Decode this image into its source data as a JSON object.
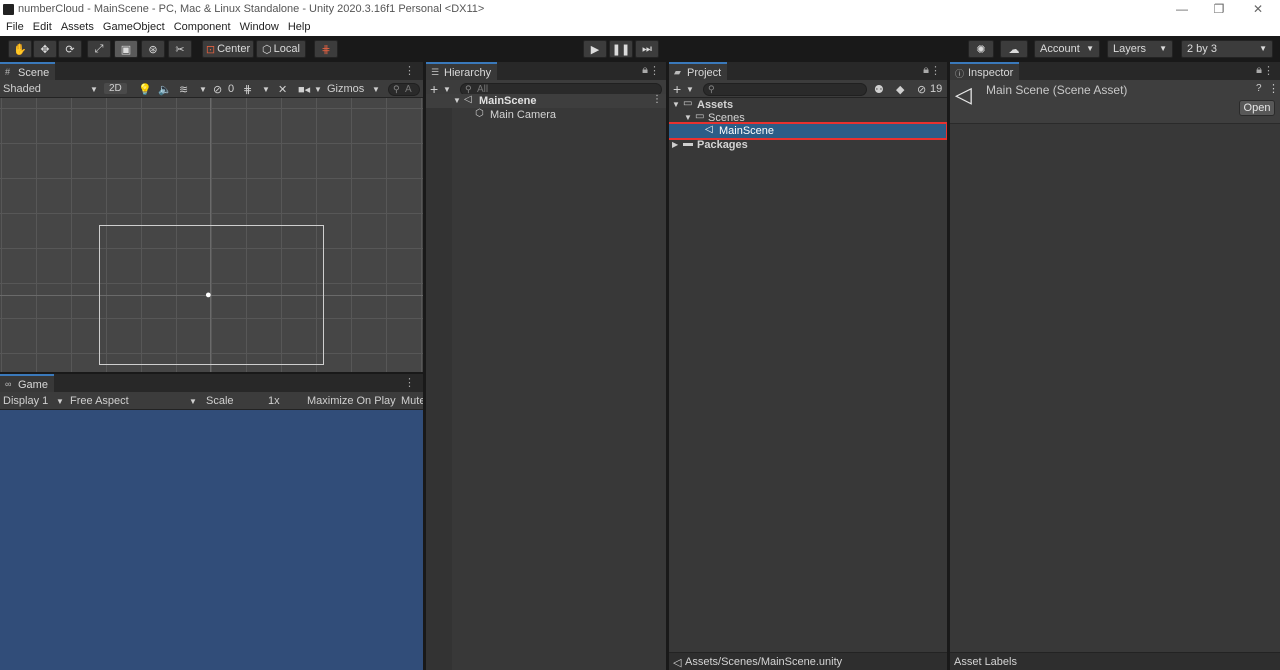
{
  "window": {
    "title": "numberCloud - MainScene - PC, Mac & Linux Standalone - Unity 2020.3.16f1 Personal <DX11>",
    "minimize": "—",
    "restore": "❐",
    "close": "✕"
  },
  "menu": [
    "File",
    "Edit",
    "Assets",
    "GameObject",
    "Component",
    "Window",
    "Help"
  ],
  "toolbar": {
    "center_label": "Center",
    "local_label": "Local",
    "account_label": "Account",
    "layers_label": "Layers",
    "layout_label": "2 by 3",
    "tools": [
      "hand-tool",
      "move-tool",
      "rotate-tool",
      "scale-tool",
      "rect-tool",
      "transform-tool",
      "custom-tool"
    ]
  },
  "scene": {
    "tab_label": "Scene",
    "shading": "Shaded",
    "mode_2d": "2D",
    "hidden_count": "0",
    "gizmos": "Gizmos",
    "search_placeholder": "A"
  },
  "game": {
    "tab_label": "Game",
    "display": "Display 1",
    "aspect": "Free Aspect",
    "scale_label": "Scale",
    "scale_value": "1x",
    "maximize": "Maximize On Play",
    "mute": "Mute",
    "background_color": "#314d79"
  },
  "hierarchy": {
    "tab_label": "Hierarchy",
    "search_placeholder": "All",
    "scene_name": "MainScene",
    "objects": [
      "Main Camera"
    ]
  },
  "project": {
    "tab_label": "Project",
    "hidden_count": "19",
    "tree": {
      "assets": "Assets",
      "scenes": "Scenes",
      "mainscene": "MainScene",
      "packages": "Packages"
    },
    "footer_path": "Assets/Scenes/MainScene.unity",
    "selected_item": "MainScene"
  },
  "inspector": {
    "tab_label": "Inspector",
    "asset_title": "Main Scene (Scene Asset)",
    "open_button": "Open",
    "footer": "Asset Labels"
  },
  "colors": {
    "accent": "#3a79bb",
    "selection": "#2c5d87",
    "highlight_outline": "#e8322f"
  }
}
